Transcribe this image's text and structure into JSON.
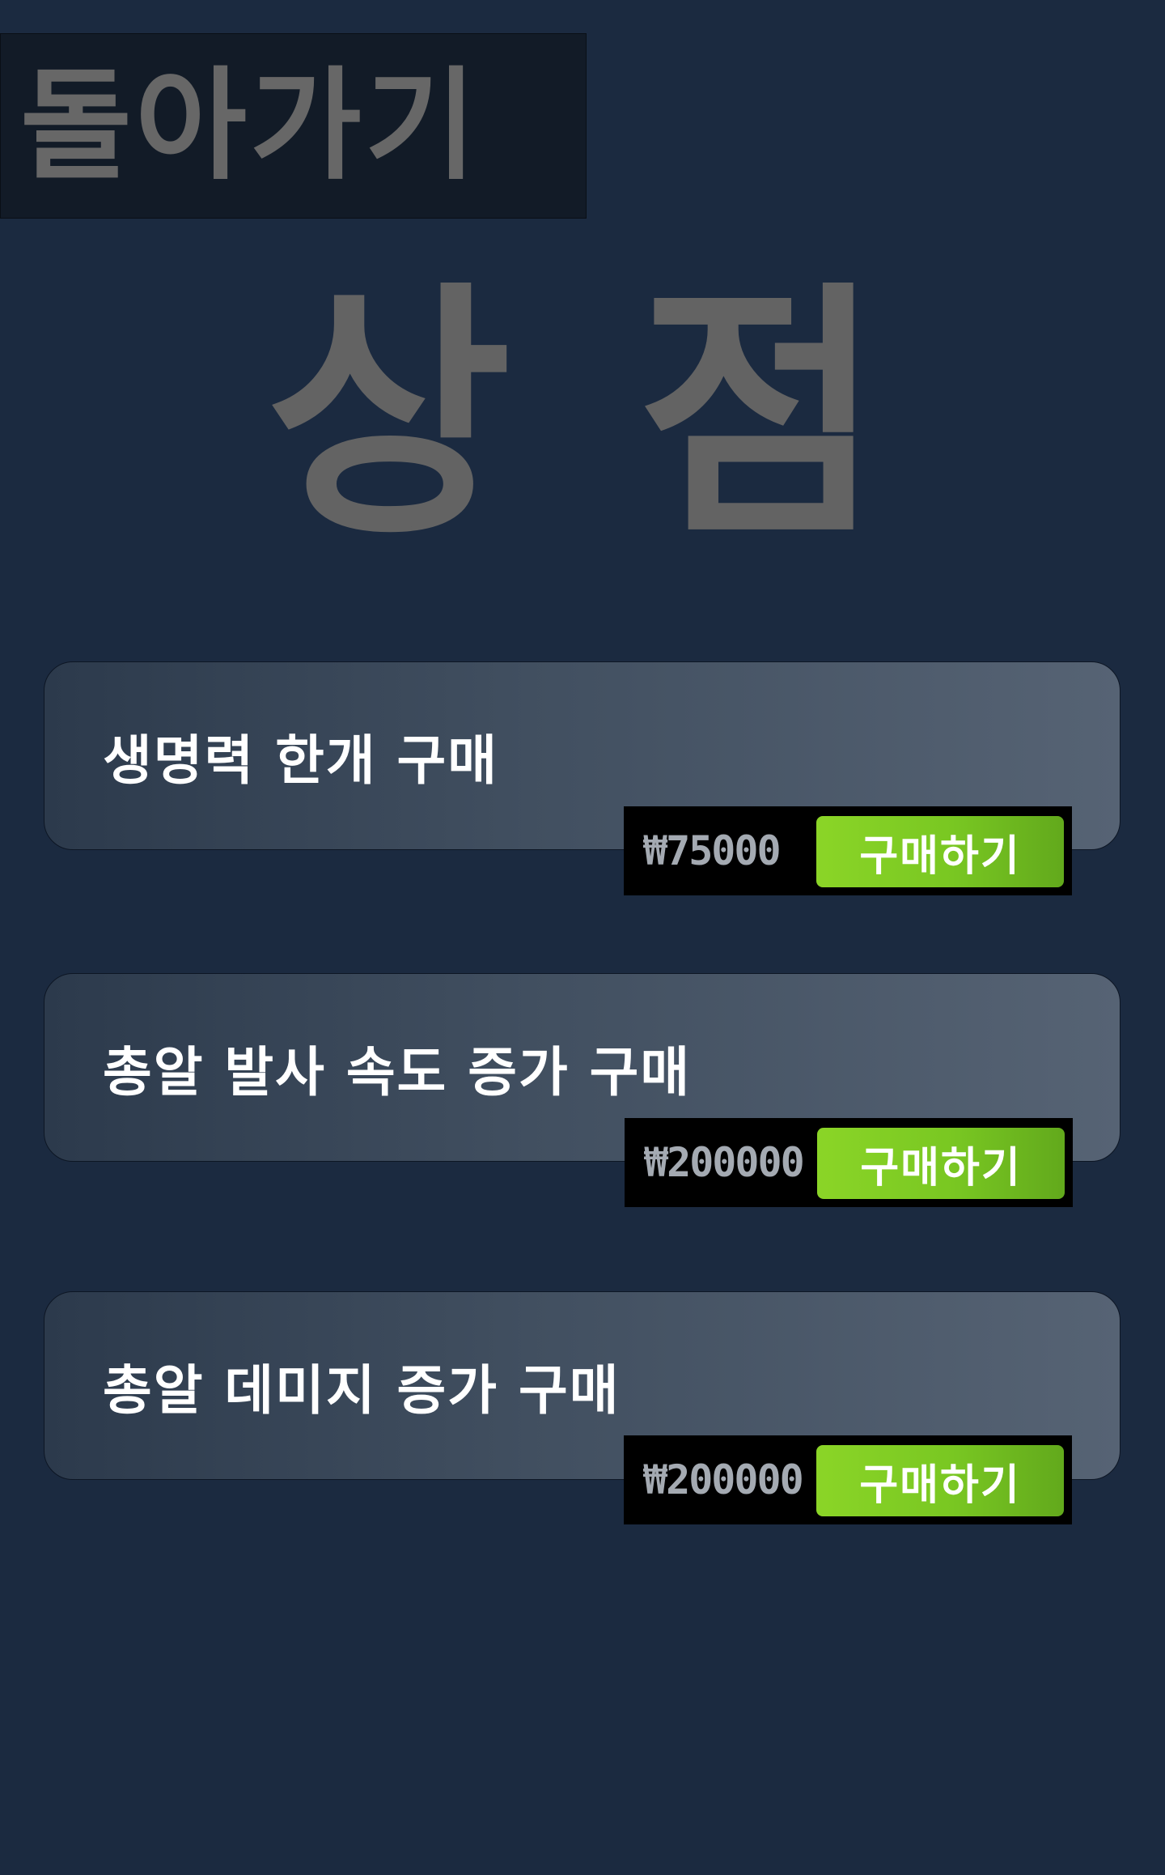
{
  "back_button": {
    "label": "돌아가기"
  },
  "title": "상 점",
  "items": [
    {
      "name": "생명력 한개 구매",
      "price": "₩75000",
      "buy_label": "구매하기"
    },
    {
      "name": "총알 발사 속도 증가 구매",
      "price": "₩200000",
      "buy_label": "구매하기"
    },
    {
      "name": "총알 데미지 증가 구매",
      "price": "₩200000",
      "buy_label": "구매하기"
    }
  ],
  "colors": {
    "background": "#1b2a40",
    "title_gray": "#636363",
    "buy_button_green": "#7ccb22",
    "price_bar": "#000000"
  }
}
